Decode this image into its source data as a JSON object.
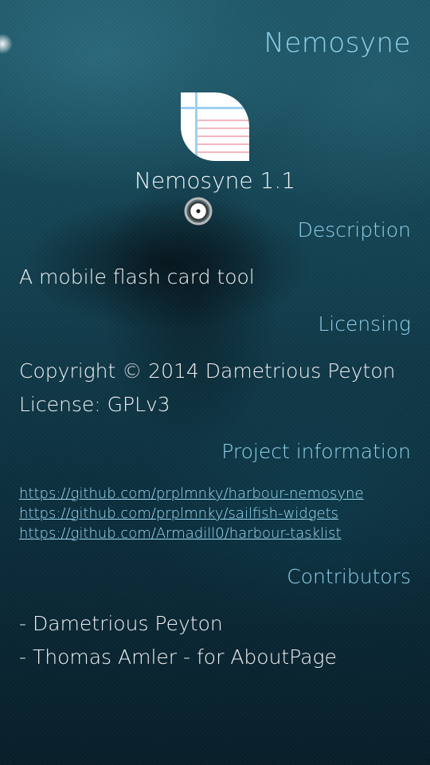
{
  "header": {
    "title": "Nemosyne"
  },
  "app": {
    "icon": "notepad-icon",
    "version_label": "Nemosyne 1.1"
  },
  "description": {
    "heading": "Description",
    "text": "A mobile flash card tool"
  },
  "licensing": {
    "heading": "Licensing",
    "copyright": "Copyright © 2014 Dametrious Peyton",
    "license": "License: GPLv3"
  },
  "project": {
    "heading": "Project information",
    "links": [
      "https://github.com/prplmnky/harbour-nemosyne",
      "https://github.com/prplmnky/sailfish-widgets",
      "https://github.com/Armadill0/harbour-tasklist"
    ]
  },
  "contributors": {
    "heading": "Contributors",
    "items": [
      "- Dametrious Peyton",
      "- Thomas Amler - for AboutPage"
    ]
  },
  "colors": {
    "highlight": "#8fd3ec",
    "primary_text": "#f2f4f5",
    "background_top": "#1e5666",
    "background_bottom": "#081f2a"
  }
}
